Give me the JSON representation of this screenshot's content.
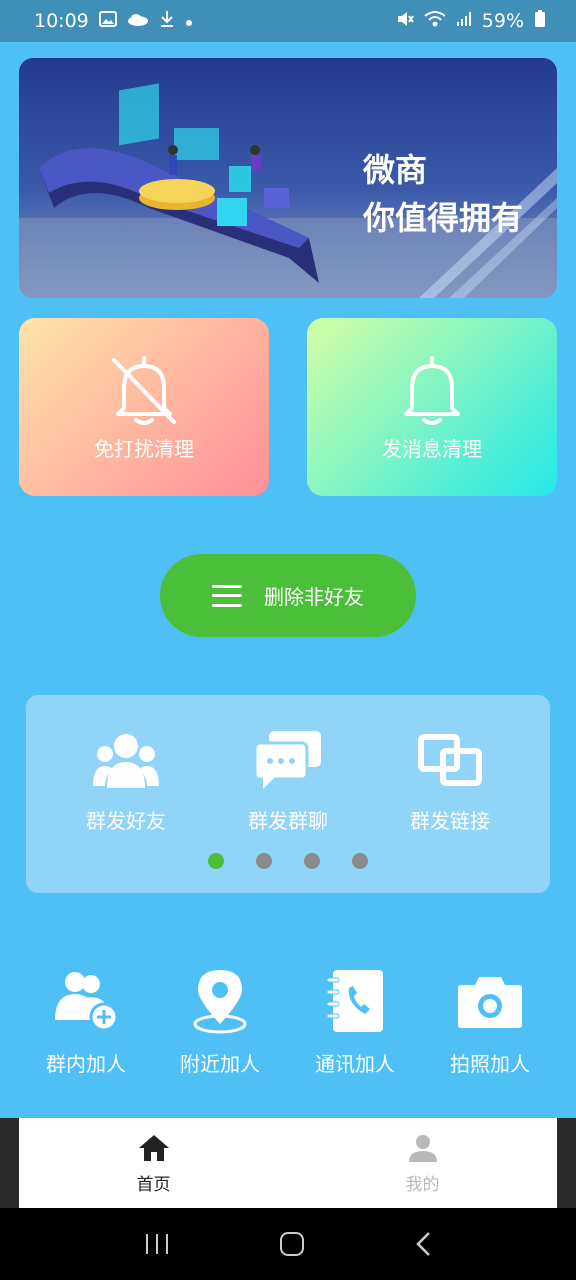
{
  "status_bar": {
    "time": "10:09",
    "battery": "59%"
  },
  "banner": {
    "line1": "微商",
    "line2": "你值得拥有"
  },
  "cards": [
    {
      "label": "免打扰清理",
      "icon": "bell-off-icon",
      "gradient": [
        "#ffe3a8",
        "#ff8f98"
      ]
    },
    {
      "label": "发消息清理",
      "icon": "bell-icon",
      "gradient": [
        "#d5ffa4",
        "#22e8e8"
      ]
    }
  ],
  "delete_button": {
    "label": "删除非好友",
    "icon": "menu-icon",
    "color": "#4cbf3a"
  },
  "carousel": {
    "items": [
      {
        "label": "群发好友",
        "icon": "group-icon"
      },
      {
        "label": "群发群聊",
        "icon": "chat-bubbles-icon"
      },
      {
        "label": "群发链接",
        "icon": "link-icon"
      }
    ],
    "page_count": 4,
    "active_page": 1
  },
  "grid": [
    {
      "label": "群内加人",
      "icon": "group-add-icon"
    },
    {
      "label": "附近加人",
      "icon": "location-pin-icon"
    },
    {
      "label": "通讯加人",
      "icon": "contacts-book-icon"
    },
    {
      "label": "拍照加人",
      "icon": "camera-icon"
    }
  ],
  "tabbar": {
    "tabs": [
      {
        "label": "首页",
        "icon": "home-icon",
        "active": true
      },
      {
        "label": "我的",
        "icon": "person-icon",
        "active": false
      }
    ]
  },
  "colors": {
    "background": "#4ec0f5",
    "accent_green": "#4cbf3a",
    "panel": "#90d4f8"
  }
}
